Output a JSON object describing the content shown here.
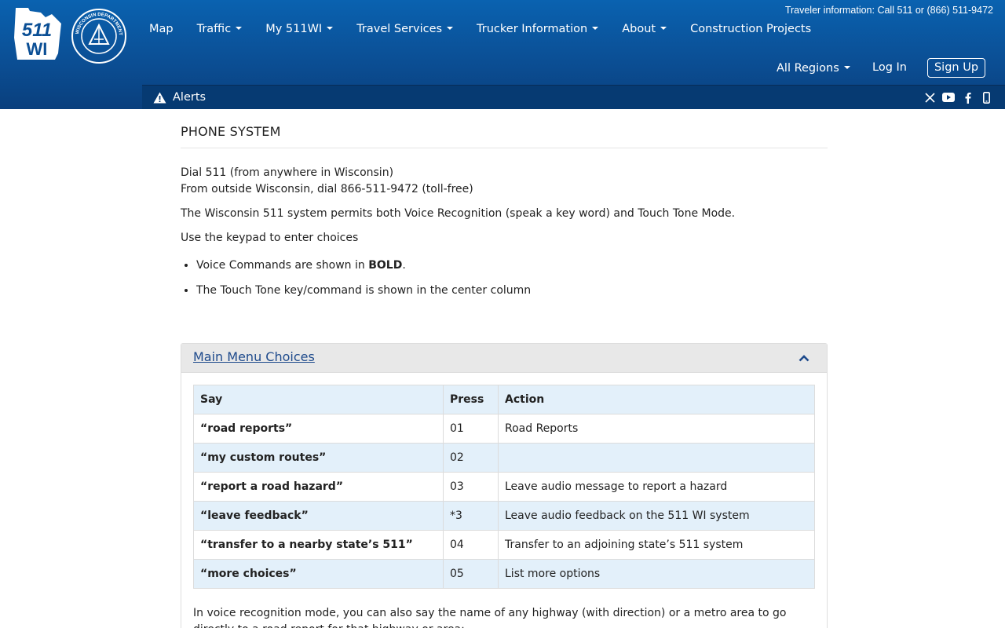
{
  "header": {
    "logo_text_line1": "511",
    "logo_text_line2": "WI",
    "seal_text": "WISCONSIN DEPARTMENT OF TRANSPORTATION",
    "top_info": "Traveler information: Call 511 or (866) 511-9472",
    "nav": [
      {
        "label": "Map"
      },
      {
        "label": "Traffic"
      },
      {
        "label": "My 511WI"
      },
      {
        "label": "Travel Services"
      },
      {
        "label": "Trucker Information"
      },
      {
        "label": "About"
      },
      {
        "label": "Construction Projects"
      }
    ],
    "region_label": "All Regions",
    "login_label": "Log In",
    "signup_label": "Sign Up",
    "alerts_label": "Alerts"
  },
  "content": {
    "title": "PHONE SYSTEM",
    "dial_line1": "Dial 511 (from anywhere in Wisconsin)",
    "dial_line2": "From outside Wisconsin, dial 866-511-9472 (toll-free)",
    "para_modes": "The Wisconsin 511 system permits both Voice Recognition (speak a key word) and Touch Tone Mode.",
    "para_keypad": "Use the keypad to enter choices",
    "bullet1_pre": "Voice Commands are shown in ",
    "bullet1_bold": "BOLD",
    "bullet1_post": ".",
    "bullet2": "The Touch Tone key/command is shown in the center column"
  },
  "panel": {
    "title": "Main Menu Choices",
    "headers": {
      "say": "Say",
      "press": "Press",
      "action": "Action"
    },
    "rows": [
      {
        "say": "“road reports”",
        "press": "01",
        "action": "Road Reports"
      },
      {
        "say": "“my custom routes”",
        "press": "02",
        "action": ""
      },
      {
        "say": "“report a road hazard”",
        "press": "03",
        "action": "Leave audio message to report a hazard"
      },
      {
        "say": "“leave feedback”",
        "press": "*3",
        "action": "Leave audio feedback on the 511 WI system"
      },
      {
        "say": "“transfer to a nearby state’s 511”",
        "press": "04",
        "action": "Transfer to an adjoining state’s 511 system"
      },
      {
        "say": "“more choices”",
        "press": "05",
        "action": "List more options"
      }
    ],
    "footer": "In voice recognition mode, you can also say the name of any highway (with direction) or a metro area to go directly to a road report for that highway or area:"
  }
}
